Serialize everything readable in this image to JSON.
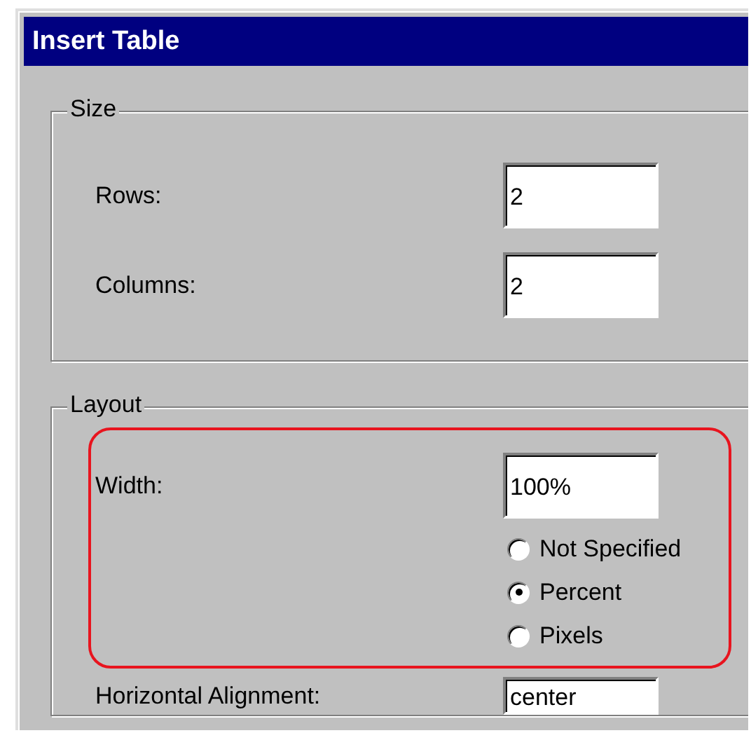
{
  "window": {
    "title": "Insert Table"
  },
  "size_group": {
    "title": "Size",
    "fields": [
      {
        "label": "Rows:",
        "value": "2"
      },
      {
        "label": "Columns:",
        "value": "2"
      }
    ]
  },
  "layout_group": {
    "title": "Layout",
    "width": {
      "label": "Width:",
      "value": "100%"
    },
    "width_units": [
      {
        "label": "Not Specified",
        "selected": false
      },
      {
        "label": "Percent",
        "selected": true
      },
      {
        "label": "Pixels",
        "selected": false
      }
    ],
    "horizontal_alignment": {
      "label": "Horizontal Alignment:",
      "value": "center"
    }
  }
}
